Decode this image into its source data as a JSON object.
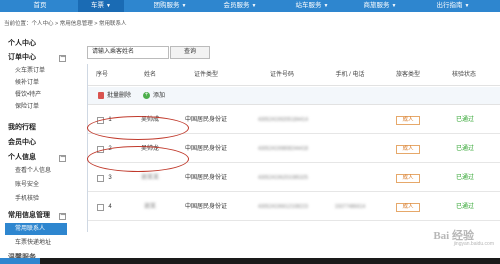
{
  "nav": {
    "items": [
      {
        "label": "首页",
        "caret": ""
      },
      {
        "label": "车票",
        "caret": "▼"
      },
      {
        "label": "团购服务",
        "caret": "▼"
      },
      {
        "label": "会员服务",
        "caret": "▼"
      },
      {
        "label": "站车服务",
        "caret": "▼"
      },
      {
        "label": "商旅服务",
        "caret": "▼"
      },
      {
        "label": "出行指南",
        "caret": "▼"
      }
    ]
  },
  "breadcrumb": "当前位置：个人中心 > 常用信息管理 > 常用联系人",
  "sidebar": {
    "personal_center": "个人中心",
    "order_center": "订单中心",
    "train_orders": "火车票订单",
    "standby_orders": "候补订单",
    "catering": "餐饮•特产",
    "insurance_orders": "保险订单",
    "my_trips": "我的行程",
    "member_center": "会员中心",
    "personal_info": "个人信息",
    "view_info": "查看个人信息",
    "account_security": "账号安全",
    "phone_verify": "手机核验",
    "common_info": "常用信息管理",
    "contacts": "常用联系人",
    "delivery_address": "车票快递地址",
    "last_partial": "温馨服务",
    "minus": "－"
  },
  "search": {
    "placeholder": "请输入乘客姓名",
    "button": "查询"
  },
  "table": {
    "headers": {
      "index": "序号",
      "name": "姓名",
      "id_type": "证件类型",
      "id_number": "证件号码",
      "phone": "手机 / 电话",
      "traveler_type": "旅客类型",
      "verify_status": "核验状态"
    },
    "toolbar": {
      "batch_delete": "批量删除",
      "add": "添加",
      "add_icon": "+"
    },
    "rows": [
      {
        "index": "1",
        "name": "吴帅成",
        "id_type": "中国居民身份证",
        "id_number": "430524199205184414",
        "phone": "",
        "traveler_type": "成人",
        "status": "已通过"
      },
      {
        "index": "2",
        "name": "吴帅龙",
        "id_type": "中国居民身份证",
        "id_number": "430524199808244418",
        "phone": "",
        "traveler_type": "成人",
        "status": "已通过"
      },
      {
        "index": "3",
        "name": "谢某某",
        "id_type": "中国居民身份证",
        "id_number": "430524196201085325",
        "phone": "",
        "traveler_type": "成人",
        "status": "已通过"
      },
      {
        "index": "4",
        "name": "谢某",
        "id_type": "中国居民身份证",
        "id_number": "430524196612108223",
        "phone": "15077486614",
        "traveler_type": "成人",
        "status": "已通过"
      }
    ]
  },
  "watermark": {
    "main": "Bai 经验",
    "sub": "jingyan.baidu.com"
  },
  "colors": {
    "nav_bg": "#2e86cf",
    "status_green": "#2aa22a",
    "tag_orange": "#d87b2a",
    "annotation_red": "#c0392b"
  }
}
